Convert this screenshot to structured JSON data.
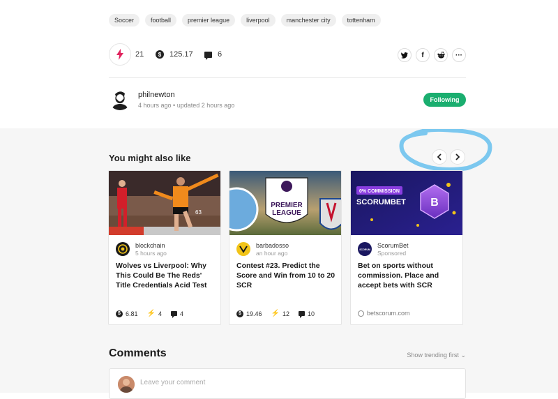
{
  "tags": [
    "Soccer",
    "football",
    "premier league",
    "liverpool",
    "manchester city",
    "tottenham"
  ],
  "stats": {
    "votes": "21",
    "payout": "125.17",
    "comments": "6"
  },
  "share": {
    "twitter": "twitter-icon",
    "facebook": "facebook-icon",
    "reddit": "reddit-icon",
    "more": "more-icon"
  },
  "author": {
    "name": "philnewton",
    "time": "4 hours ago • updated 2 hours ago",
    "follow_label": "Following"
  },
  "related": {
    "title": "You might also like",
    "cards": [
      {
        "author": "blockchain",
        "time": "5 hours ago",
        "title": "Wolves vs Liverpool: Why This Could Be The Reds' Title Credentials Acid Test",
        "payout": "6.81",
        "votes": "4",
        "comments": "4"
      },
      {
        "author": "barbadosso",
        "time": "an hour ago",
        "title": "Contest #23. Predict the Score and Win from 10 to 20 SCR",
        "payout": "19.46",
        "votes": "12",
        "comments": "10"
      },
      {
        "author": "ScorumBet",
        "time": "Sponsored",
        "title": "Bet on sports without commission. Place and accept bets with SCR",
        "domain": "betscorum.com",
        "badge": "0% COMMISSION",
        "brand": "SCORUMBET",
        "avatar_text": "SCORUM"
      }
    ],
    "league_text": [
      "PREMIER",
      "LEAGUE"
    ]
  },
  "comments": {
    "title": "Comments",
    "sort_label": "Show trending first",
    "placeholder": "Leave your comment"
  },
  "colors": {
    "accent": "#1aae6f",
    "bolt": "#e0245e",
    "annotation": "#7cc8ef"
  }
}
